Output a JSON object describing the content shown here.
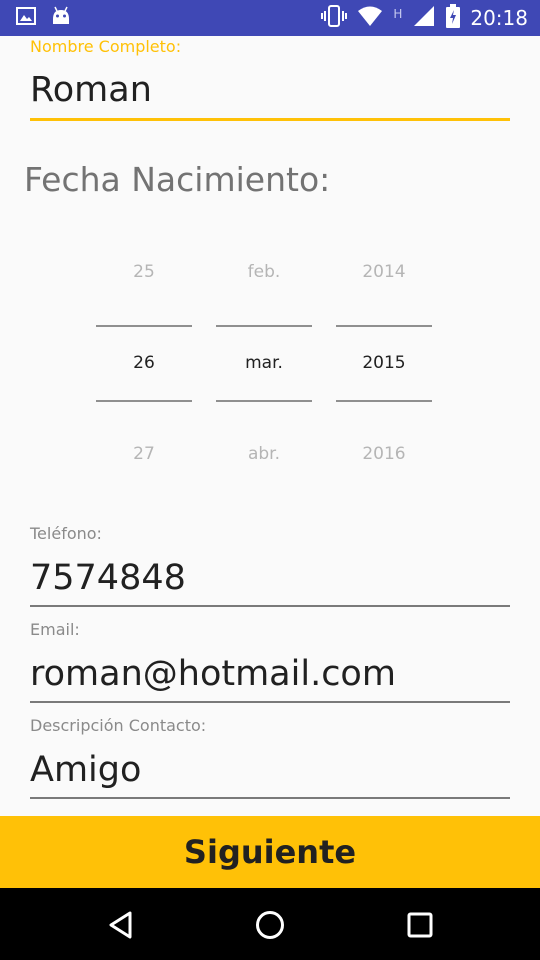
{
  "status_bar": {
    "time": "20:18",
    "network_label": "H",
    "icons": [
      "image-icon",
      "android-icon",
      "vibrate-icon",
      "wifi-icon",
      "signal-icon",
      "battery-icon"
    ]
  },
  "form": {
    "name": {
      "label": "Nombre Completo:",
      "value": "Roman"
    },
    "birth_title": "Fecha Nacimiento:",
    "date_picker": {
      "day": {
        "prev": "25",
        "selected": "26",
        "next": "27"
      },
      "month": {
        "prev": "feb.",
        "selected": "mar.",
        "next": "abr."
      },
      "year": {
        "prev": "2014",
        "selected": "2015",
        "next": "2016"
      }
    },
    "phone": {
      "label": "Teléfono:",
      "value": "7574848"
    },
    "email": {
      "label": "Email:",
      "value": "roman@hotmail.com"
    },
    "description": {
      "label": "Descripción Contacto:",
      "value": "Amigo"
    }
  },
  "actions": {
    "next_label": "Siguiente"
  },
  "colors": {
    "status_bar": "#3f48b5",
    "accent": "#ffc107",
    "nav_bar": "#000000"
  }
}
